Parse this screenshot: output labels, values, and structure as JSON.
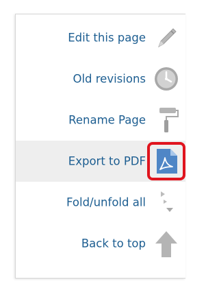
{
  "menu": {
    "items": [
      {
        "label": "Edit this page",
        "icon": "pencil-icon"
      },
      {
        "label": "Old revisions",
        "icon": "clock-icon"
      },
      {
        "label": "Rename Page",
        "icon": "paint-roller-icon"
      },
      {
        "label": "Export to PDF",
        "icon": "pdf-document-icon",
        "highlighted": true,
        "annotated": true
      },
      {
        "label": "Fold/unfold all",
        "icon": "fold-arrows-icon"
      },
      {
        "label": "Back to top",
        "icon": "up-arrow-icon"
      }
    ]
  },
  "colors": {
    "link": "#1d5e91",
    "highlight_bg": "#eeeeee",
    "annotation": "#e0141e",
    "pdf_icon_bg": "#4f86c6"
  }
}
